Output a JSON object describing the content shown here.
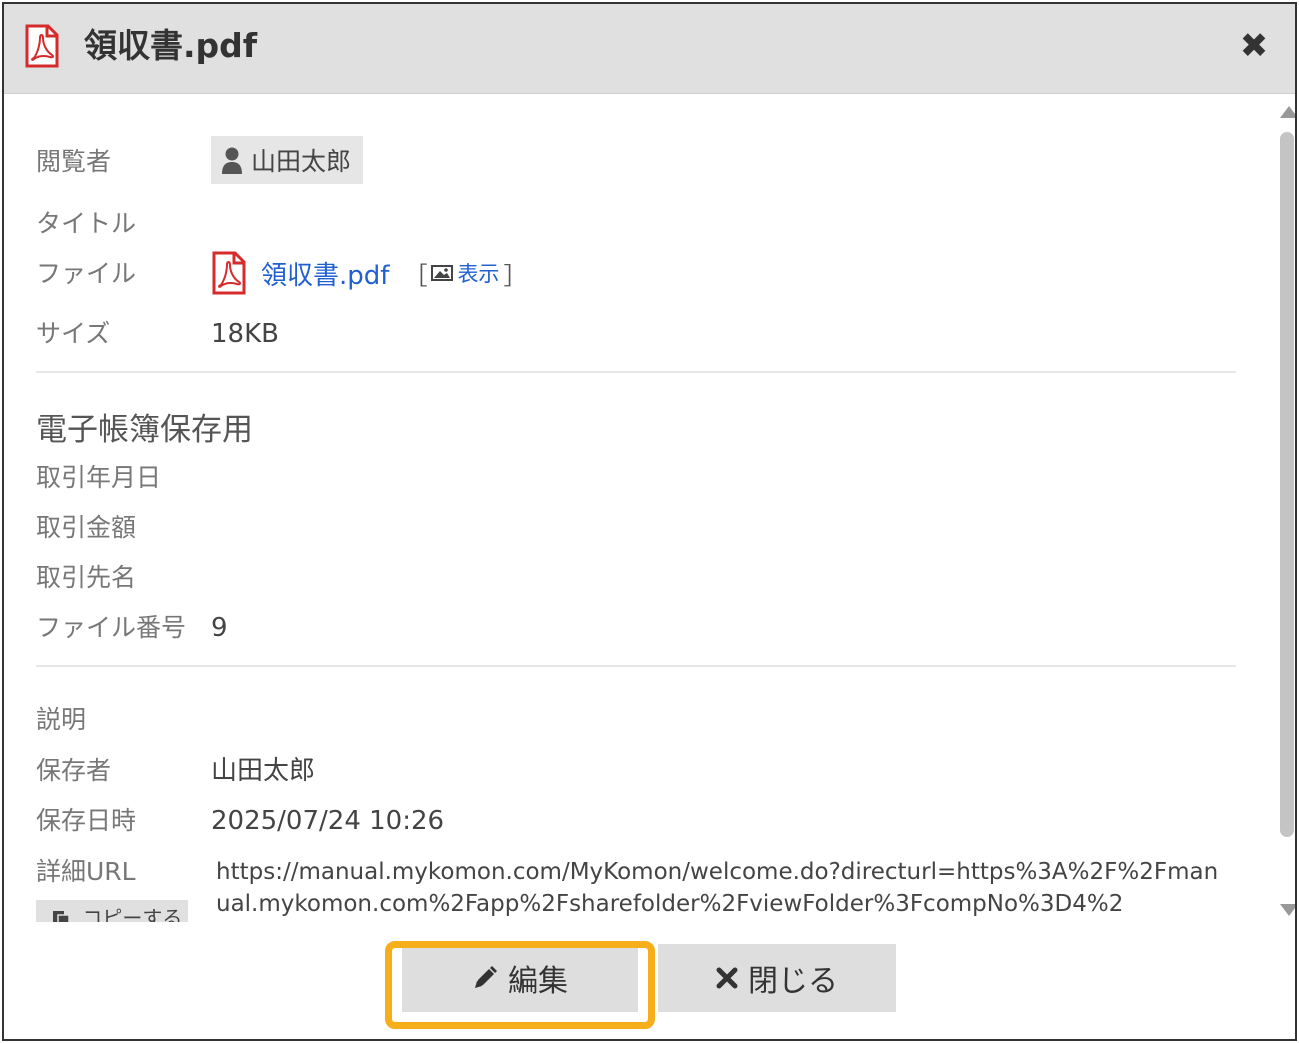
{
  "dialog": {
    "title": "領収書.pdf",
    "close_symbol": "✖"
  },
  "fields": {
    "viewer_label": "閲覧者",
    "viewer_value": "山田太郎",
    "title_label": "タイトル",
    "file_label": "ファイル",
    "file_name": "領収書.pdf",
    "bracket_open": "［",
    "view_label": "表示",
    "bracket_close": "］",
    "size_label": "サイズ",
    "size_value": "18KB"
  },
  "section": {
    "title": "電子帳簿保存用",
    "date_label": "取引年月日",
    "amount_label": "取引金額",
    "partner_label": "取引先名",
    "file_no_label": "ファイル番号",
    "file_no_value": "9"
  },
  "details": {
    "description_label": "説明",
    "saver_label": "保存者",
    "saver_value": "山田太郎",
    "saved_at_label": "保存日時",
    "saved_at_value": "2025/07/24 10:26",
    "url_label": "詳細URL",
    "url_value": "https://manual.mykomon.com/MyKomon/welcome.do?directurl=https%3A%2F%2Fmanual.mykomon.com%2Fapp%2Fsharefolder%2FviewFolder%3FcompNo%3D4%2",
    "copy_label": "コピーする"
  },
  "footer": {
    "edit_label": "編集",
    "close_label": "閉じる"
  },
  "colors": {
    "accent_highlight": "#f6ae1a",
    "link": "#2060d0",
    "pdf_red": "#d62b2b"
  },
  "icons": {
    "title_icon": "pdf-icon",
    "viewer_icon": "user-icon",
    "file_icon": "pdf-icon",
    "view_icon": "image-icon",
    "copy_icon": "copy-icon",
    "edit_icon": "pencil-icon",
    "close_icon": "close-icon"
  }
}
